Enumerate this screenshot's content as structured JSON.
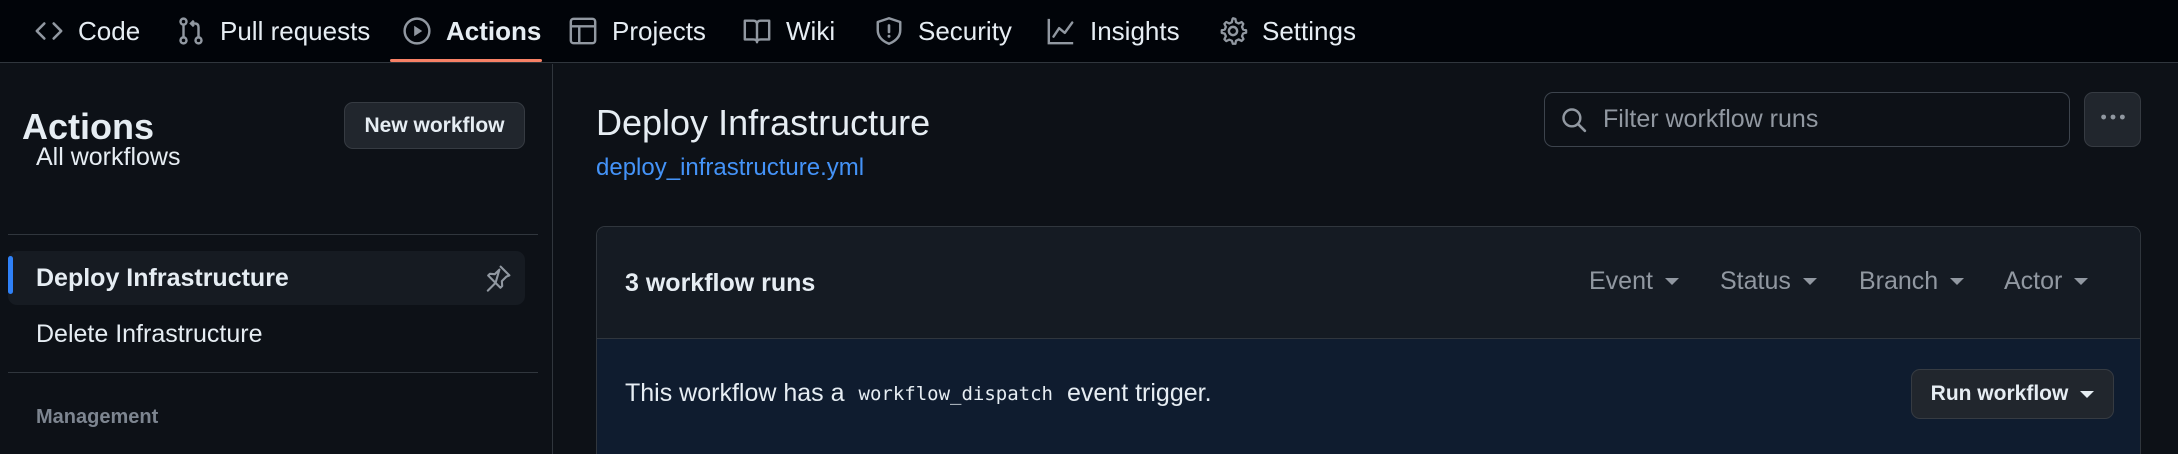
{
  "nav": {
    "tabs": [
      {
        "label": "Code",
        "icon": "code-icon"
      },
      {
        "label": "Pull requests",
        "icon": "git-pull-request-icon"
      },
      {
        "label": "Actions",
        "icon": "play-circle-icon",
        "active": true
      },
      {
        "label": "Projects",
        "icon": "table-icon"
      },
      {
        "label": "Wiki",
        "icon": "book-icon"
      },
      {
        "label": "Security",
        "icon": "shield-icon"
      },
      {
        "label": "Insights",
        "icon": "graph-icon"
      },
      {
        "label": "Settings",
        "icon": "gear-icon"
      }
    ],
    "active_underline_color": "#f78166"
  },
  "sidebar": {
    "title": "Actions",
    "new_workflow_label": "New workflow",
    "all_workflows_label": "All workflows",
    "workflows": [
      {
        "label": "Deploy Infrastructure",
        "selected": true,
        "pinned_icon": "pin-icon"
      },
      {
        "label": "Delete Infrastructure",
        "selected": false
      }
    ],
    "management_heading": "Management"
  },
  "main": {
    "workflow_title": "Deploy Infrastructure",
    "workflow_file": "deploy_infrastructure.yml",
    "search_placeholder": "Filter workflow runs",
    "runs_count_label": "3 workflow runs",
    "filters": [
      "Event",
      "Status",
      "Branch",
      "Actor"
    ],
    "trigger_prefix": "This workflow has a",
    "trigger_code": "workflow_dispatch",
    "trigger_suffix": "event trigger.",
    "run_workflow_label": "Run workflow"
  },
  "colors": {
    "background": "#0d1117",
    "header_bg": "#010409",
    "link": "#4493f8",
    "selection_accent": "#2f81f7"
  }
}
